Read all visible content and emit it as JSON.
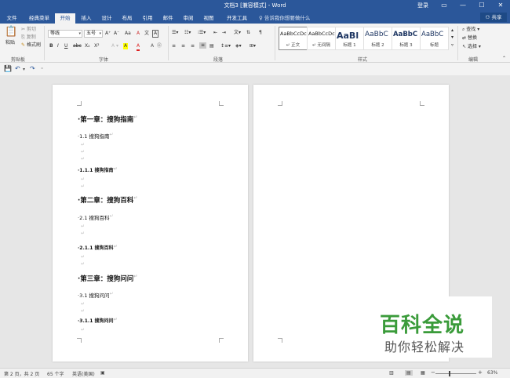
{
  "window": {
    "title": "文档3 [兼容模式] - Word",
    "login": "登录",
    "controls": [
      "▭",
      "—",
      "☐",
      "✕"
    ]
  },
  "tabs": [
    {
      "label": "文件",
      "active": false
    },
    {
      "label": "经典菜单",
      "active": false
    },
    {
      "label": "开始",
      "active": true
    },
    {
      "label": "插入",
      "active": false
    },
    {
      "label": "设计",
      "active": false
    },
    {
      "label": "布局",
      "active": false
    },
    {
      "label": "引用",
      "active": false
    },
    {
      "label": "邮件",
      "active": false
    },
    {
      "label": "审阅",
      "active": false
    },
    {
      "label": "视图",
      "active": false
    },
    {
      "label": "开发工具",
      "active": false
    }
  ],
  "tell_me": "告诉我你想要做什么",
  "share": "共享",
  "ribbon": {
    "clipboard": {
      "paste": "粘贴",
      "cut": "剪切",
      "copy": "复制",
      "format_painter": "格式刷",
      "label": "剪贴板"
    },
    "font": {
      "font_name": "等线",
      "font_size": "五号",
      "label": "字体",
      "bold": "B",
      "italic": "I",
      "underline": "U",
      "strike": "abc",
      "sub": "X₂",
      "sup": "X²",
      "grow": "A⁺",
      "shrink": "A⁻",
      "case": "Aa",
      "clear": "A",
      "phonetic": "文",
      "border": "A",
      "highlight": "A",
      "color": "A"
    },
    "paragraph": {
      "label": "段落"
    },
    "styles": {
      "label": "样式",
      "items": [
        {
          "sample": "AaBbCcDc",
          "name": "↵ 正文",
          "selected": true,
          "size": 6.5,
          "bold": false
        },
        {
          "sample": "AaBbCcDc",
          "name": "↵ 无间隔",
          "selected": false,
          "size": 6.5,
          "bold": false
        },
        {
          "sample": "AaBl",
          "name": "标题 1",
          "selected": false,
          "size": 11,
          "bold": true
        },
        {
          "sample": "AaBbC",
          "name": "标题 2",
          "selected": false,
          "size": 9,
          "bold": false
        },
        {
          "sample": "AaBbC",
          "name": "标题 3",
          "selected": false,
          "size": 8.5,
          "bold": true
        },
        {
          "sample": "AaBbC",
          "name": "标题",
          "selected": false,
          "size": 8.5,
          "bold": false
        }
      ]
    },
    "editing": {
      "label": "编辑",
      "find": "查找",
      "replace": "替换",
      "select": "选择"
    }
  },
  "document": {
    "lines": [
      {
        "text": "第一章：搜狗指南",
        "level": 1
      },
      {
        "text": "1.1 搜狗指南",
        "level": 2
      },
      {
        "text": "1.1.1 搜狗指南",
        "level": 3
      },
      {
        "text": "第二章：搜狗百科",
        "level": 1
      },
      {
        "text": "2.1 搜狗百科",
        "level": 2
      },
      {
        "text": "2.1.1 搜狗百科",
        "level": 3
      },
      {
        "text": "第三章：搜狗问问",
        "level": 1
      },
      {
        "text": "3.1 搜狗问问",
        "level": 2
      },
      {
        "text": "3.1.1 搜狗问问",
        "level": 3
      }
    ]
  },
  "watermark": {
    "title": "百科全说",
    "subtitle": "助你轻松解决"
  },
  "status": {
    "page": "第 2 页，共 2 页",
    "words": "65 个字",
    "language": "英语(美国)",
    "zoom": "63%"
  }
}
